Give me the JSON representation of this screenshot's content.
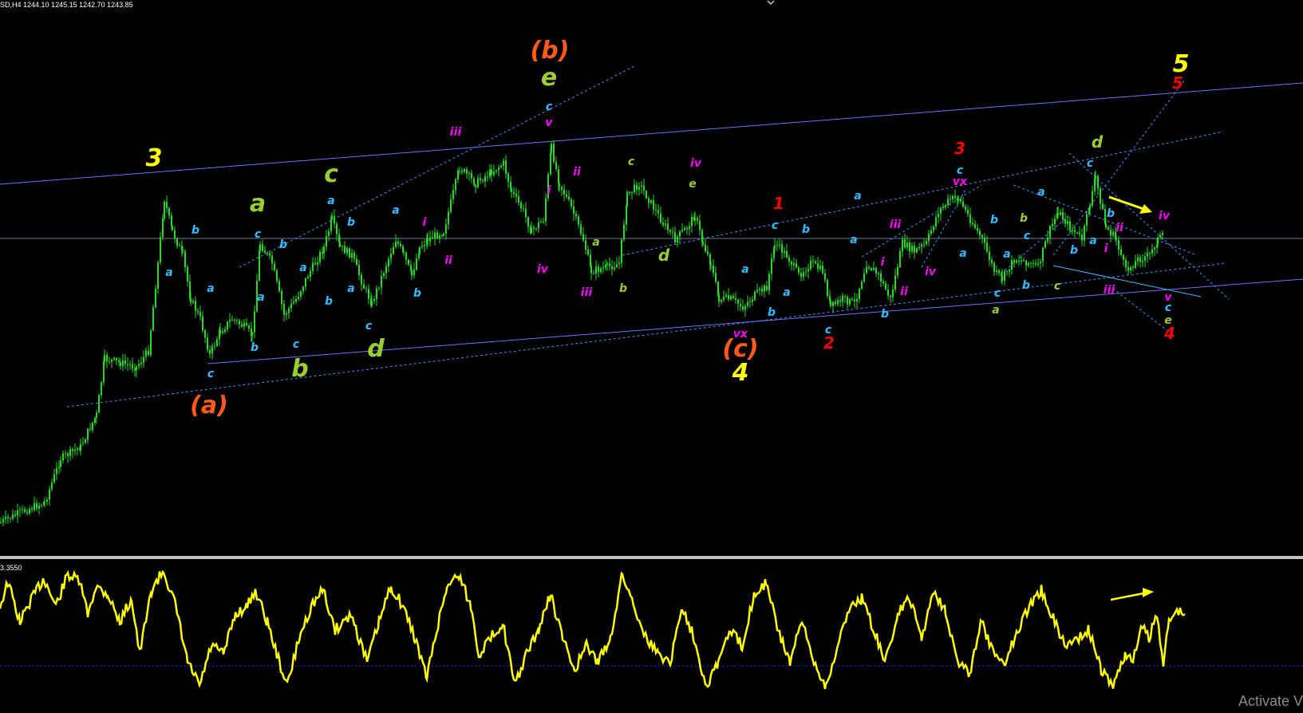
{
  "header": {
    "symbol": "SD,H4",
    "ohlc": "1244.10 1245.15 1242.70 1243.85"
  },
  "oscillator": {
    "value_label": "3.3550",
    "line_color": "#ffff00",
    "midline_color": "#1f1fcc"
  },
  "watermark": "Activate V",
  "colors": {
    "background": "#000000",
    "candle": "#22dd22",
    "channel_line": "#7070ff",
    "dotted_line": "#3399ff",
    "price_line": "#9aa0c8",
    "arrow": "#ffff00",
    "separator": "#c0c0c0"
  },
  "chart_data": [
    {
      "type": "line",
      "name": "price",
      "x_range": [
        0,
        1633
      ],
      "y_range_pixels_note": "",
      "wave_labels": [
        {
          "text": "3",
          "color": "#ffff00",
          "size": "big",
          "x": 193,
          "y": 208
        },
        {
          "text": "(a)",
          "color": "#ff5a1a",
          "size": "big",
          "x": 262,
          "y": 518
        },
        {
          "text": "(b)",
          "color": "#ff5a1a",
          "size": "big",
          "x": 689,
          "y": 73
        },
        {
          "text": "(c)",
          "color": "#ff5a1a",
          "size": "big",
          "x": 928,
          "y": 447
        },
        {
          "text": "4",
          "color": "#ffff00",
          "size": "big",
          "x": 928,
          "y": 477
        },
        {
          "text": "5",
          "color": "#ffff00",
          "size": "big",
          "x": 1480,
          "y": 90
        },
        {
          "text": "5",
          "color": "#ff0000",
          "size": "mid",
          "x": 1476,
          "y": 111
        },
        {
          "text": "a",
          "color": "#9acd32",
          "size": "big",
          "x": 323,
          "y": 265
        },
        {
          "text": "b",
          "color": "#9acd32",
          "size": "big",
          "x": 376,
          "y": 472
        },
        {
          "text": "c",
          "color": "#9acd32",
          "size": "big",
          "x": 415,
          "y": 228
        },
        {
          "text": "d",
          "color": "#9acd32",
          "size": "big",
          "x": 471,
          "y": 447
        },
        {
          "text": "e",
          "color": "#9acd32",
          "size": "big",
          "x": 688,
          "y": 107
        },
        {
          "text": "iii",
          "color": "#ff00ff",
          "size": "small",
          "x": 571,
          "y": 170
        },
        {
          "text": "c",
          "color": "#33bbff",
          "size": "small",
          "x": 688,
          "y": 138
        },
        {
          "text": "v",
          "color": "#ff00ff",
          "size": "small",
          "x": 688,
          "y": 158
        },
        {
          "text": "ii",
          "color": "#ff00ff",
          "size": "small",
          "x": 723,
          "y": 220
        },
        {
          "text": "i",
          "color": "#ff00ff",
          "size": "small",
          "x": 688,
          "y": 243
        },
        {
          "text": "c",
          "color": "#9acd32",
          "size": "small",
          "x": 791,
          "y": 207
        },
        {
          "text": "iv",
          "color": "#ff00ff",
          "size": "small",
          "x": 872,
          "y": 209
        },
        {
          "text": "e",
          "color": "#9acd32",
          "size": "small",
          "x": 868,
          "y": 235
        },
        {
          "text": "a",
          "color": "#9acd32",
          "size": "small",
          "x": 747,
          "y": 308
        },
        {
          "text": "d",
          "color": "#9acd32",
          "size": "mid",
          "x": 832,
          "y": 327
        },
        {
          "text": "iv",
          "color": "#ff00ff",
          "size": "small",
          "x": 680,
          "y": 342
        },
        {
          "text": "iii",
          "color": "#ff00ff",
          "size": "small",
          "x": 735,
          "y": 371
        },
        {
          "text": "b",
          "color": "#9acd32",
          "size": "small",
          "x": 781,
          "y": 366
        },
        {
          "text": "b",
          "color": "#33bbff",
          "size": "small",
          "x": 245,
          "y": 293
        },
        {
          "text": "a",
          "color": "#33bbff",
          "size": "small",
          "x": 212,
          "y": 346
        },
        {
          "text": "a",
          "color": "#33bbff",
          "size": "small",
          "x": 264,
          "y": 366
        },
        {
          "text": "c",
          "color": "#33bbff",
          "size": "small",
          "x": 264,
          "y": 473
        },
        {
          "text": "c",
          "color": "#33bbff",
          "size": "small",
          "x": 323,
          "y": 298
        },
        {
          "text": "b",
          "color": "#33bbff",
          "size": "small",
          "x": 355,
          "y": 311
        },
        {
          "text": "a",
          "color": "#33bbff",
          "size": "small",
          "x": 327,
          "y": 377
        },
        {
          "text": "a",
          "color": "#33bbff",
          "size": "small",
          "x": 380,
          "y": 340
        },
        {
          "text": "b",
          "color": "#33bbff",
          "size": "small",
          "x": 319,
          "y": 440
        },
        {
          "text": "c",
          "color": "#33bbff",
          "size": "small",
          "x": 371,
          "y": 436
        },
        {
          "text": "a",
          "color": "#33bbff",
          "size": "small",
          "x": 415,
          "y": 256
        },
        {
          "text": "b",
          "color": "#33bbff",
          "size": "small",
          "x": 440,
          "y": 283
        },
        {
          "text": "b",
          "color": "#33bbff",
          "size": "small",
          "x": 412,
          "y": 382
        },
        {
          "text": "a",
          "color": "#33bbff",
          "size": "small",
          "x": 440,
          "y": 366
        },
        {
          "text": "c",
          "color": "#33bbff",
          "size": "small",
          "x": 462,
          "y": 413
        },
        {
          "text": "a",
          "color": "#33bbff",
          "size": "small",
          "x": 496,
          "y": 268
        },
        {
          "text": "i",
          "color": "#ff00ff",
          "size": "small",
          "x": 532,
          "y": 283
        },
        {
          "text": "ii",
          "color": "#ff00ff",
          "size": "small",
          "x": 562,
          "y": 331
        },
        {
          "text": "b",
          "color": "#33bbff",
          "size": "small",
          "x": 523,
          "y": 372
        },
        {
          "text": "1",
          "color": "#ff0000",
          "size": "mid",
          "x": 976,
          "y": 262
        },
        {
          "text": "c",
          "color": "#33bbff",
          "size": "small",
          "x": 971,
          "y": 287
        },
        {
          "text": "b",
          "color": "#33bbff",
          "size": "small",
          "x": 1010,
          "y": 292
        },
        {
          "text": "a",
          "color": "#33bbff",
          "size": "small",
          "x": 934,
          "y": 342
        },
        {
          "text": "a",
          "color": "#33bbff",
          "size": "small",
          "x": 986,
          "y": 371
        },
        {
          "text": "b",
          "color": "#33bbff",
          "size": "small",
          "x": 967,
          "y": 396
        },
        {
          "text": "vx",
          "color": "#ff00ff",
          "size": "small",
          "x": 928,
          "y": 423
        },
        {
          "text": "c",
          "color": "#33bbff",
          "size": "small",
          "x": 1038,
          "y": 418
        },
        {
          "text": "2",
          "color": "#ff0000",
          "size": "mid",
          "x": 1039,
          "y": 437
        },
        {
          "text": "a",
          "color": "#33bbff",
          "size": "small",
          "x": 1070,
          "y": 305
        },
        {
          "text": "a",
          "color": "#33bbff",
          "size": "small",
          "x": 1075,
          "y": 250
        },
        {
          "text": "iii",
          "color": "#ff00ff",
          "size": "small",
          "x": 1122,
          "y": 286
        },
        {
          "text": "i",
          "color": "#ff00ff",
          "size": "small",
          "x": 1106,
          "y": 333
        },
        {
          "text": "ii",
          "color": "#ff00ff",
          "size": "small",
          "x": 1133,
          "y": 370
        },
        {
          "text": "b",
          "color": "#33bbff",
          "size": "small",
          "x": 1109,
          "y": 398
        },
        {
          "text": "iv",
          "color": "#ff00ff",
          "size": "small",
          "x": 1166,
          "y": 345
        },
        {
          "text": "3",
          "color": "#ff0000",
          "size": "mid",
          "x": 1203,
          "y": 193
        },
        {
          "text": "c",
          "color": "#33bbff",
          "size": "small",
          "x": 1203,
          "y": 218
        },
        {
          "text": "vx",
          "color": "#ff00ff",
          "size": "small",
          "x": 1203,
          "y": 232
        },
        {
          "text": "a",
          "color": "#33bbff",
          "size": "small",
          "x": 1207,
          "y": 322
        },
        {
          "text": "b",
          "color": "#33bbff",
          "size": "small",
          "x": 1246,
          "y": 280
        },
        {
          "text": "c",
          "color": "#33bbff",
          "size": "small",
          "x": 1250,
          "y": 372
        },
        {
          "text": "a",
          "color": "#9acd32",
          "size": "small",
          "x": 1248,
          "y": 393
        },
        {
          "text": "a",
          "color": "#33bbff",
          "size": "small",
          "x": 1262,
          "y": 323
        },
        {
          "text": "b",
          "color": "#9acd32",
          "size": "small",
          "x": 1283,
          "y": 278
        },
        {
          "text": "c",
          "color": "#33bbff",
          "size": "small",
          "x": 1287,
          "y": 300
        },
        {
          "text": "b",
          "color": "#33bbff",
          "size": "small",
          "x": 1286,
          "y": 362
        },
        {
          "text": "a",
          "color": "#33bbff",
          "size": "small",
          "x": 1305,
          "y": 245
        },
        {
          "text": "c",
          "color": "#9acd32",
          "size": "small",
          "x": 1325,
          "y": 363
        },
        {
          "text": "b",
          "color": "#33bbff",
          "size": "small",
          "x": 1346,
          "y": 318
        },
        {
          "text": "d",
          "color": "#9acd32",
          "size": "mid",
          "x": 1375,
          "y": 185
        },
        {
          "text": "c",
          "color": "#33bbff",
          "size": "small",
          "x": 1366,
          "y": 209
        },
        {
          "text": "a",
          "color": "#33bbff",
          "size": "small",
          "x": 1370,
          "y": 306
        },
        {
          "text": "b",
          "color": "#33bbff",
          "size": "small",
          "x": 1392,
          "y": 272
        },
        {
          "text": "ii",
          "color": "#ff00ff",
          "size": "small",
          "x": 1403,
          "y": 290
        },
        {
          "text": "i",
          "color": "#ff00ff",
          "size": "small",
          "x": 1386,
          "y": 316
        },
        {
          "text": "iii",
          "color": "#ff00ff",
          "size": "small",
          "x": 1390,
          "y": 368
        },
        {
          "text": "iv",
          "color": "#ff00ff",
          "size": "small",
          "x": 1459,
          "y": 275
        },
        {
          "text": "v",
          "color": "#ff00ff",
          "size": "small",
          "x": 1464,
          "y": 377
        },
        {
          "text": "c",
          "color": "#33bbff",
          "size": "small",
          "x": 1464,
          "y": 390
        },
        {
          "text": "e",
          "color": "#9acd32",
          "size": "small",
          "x": 1464,
          "y": 406
        },
        {
          "text": "4",
          "color": "#ff0000",
          "size": "mid",
          "x": 1466,
          "y": 425
        }
      ]
    },
    {
      "type": "line",
      "name": "oscillator",
      "grid": false
    }
  ]
}
